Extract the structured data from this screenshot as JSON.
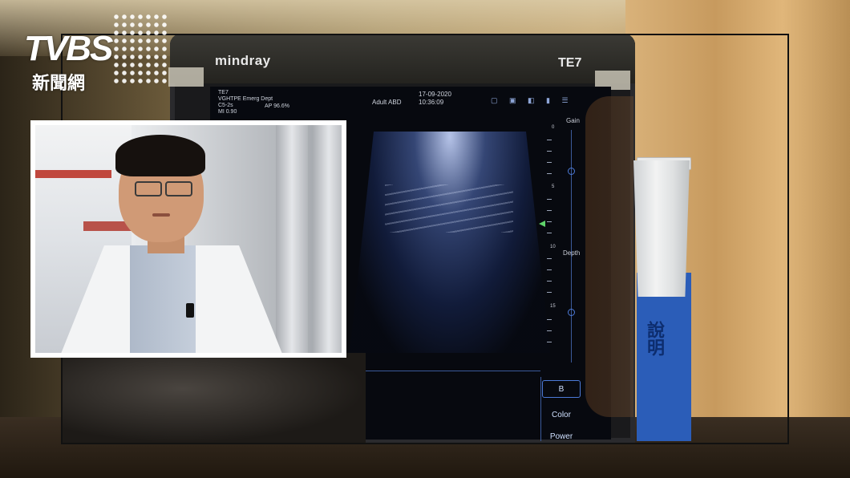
{
  "logo": {
    "brand": "TVBS",
    "subtitle": "新聞網"
  },
  "device": {
    "brand": "mindray",
    "model": "TE7"
  },
  "screen": {
    "header_left": [
      "TE7",
      "VGHTPE Emerg Dept",
      "C5-2s",
      "MI 0.90"
    ],
    "ap_value": "AP 96.6%",
    "preset": "Adult ABD",
    "date": "17-09-2020",
    "time": "10:36:09",
    "depth_scale": [
      "0",
      "5",
      "10",
      "15"
    ],
    "gain_label": "Gain",
    "depth_label": "Depth",
    "modes": [
      "B",
      "Color",
      "Power"
    ],
    "active_mode": "B"
  },
  "poster": {
    "text": "說明"
  }
}
